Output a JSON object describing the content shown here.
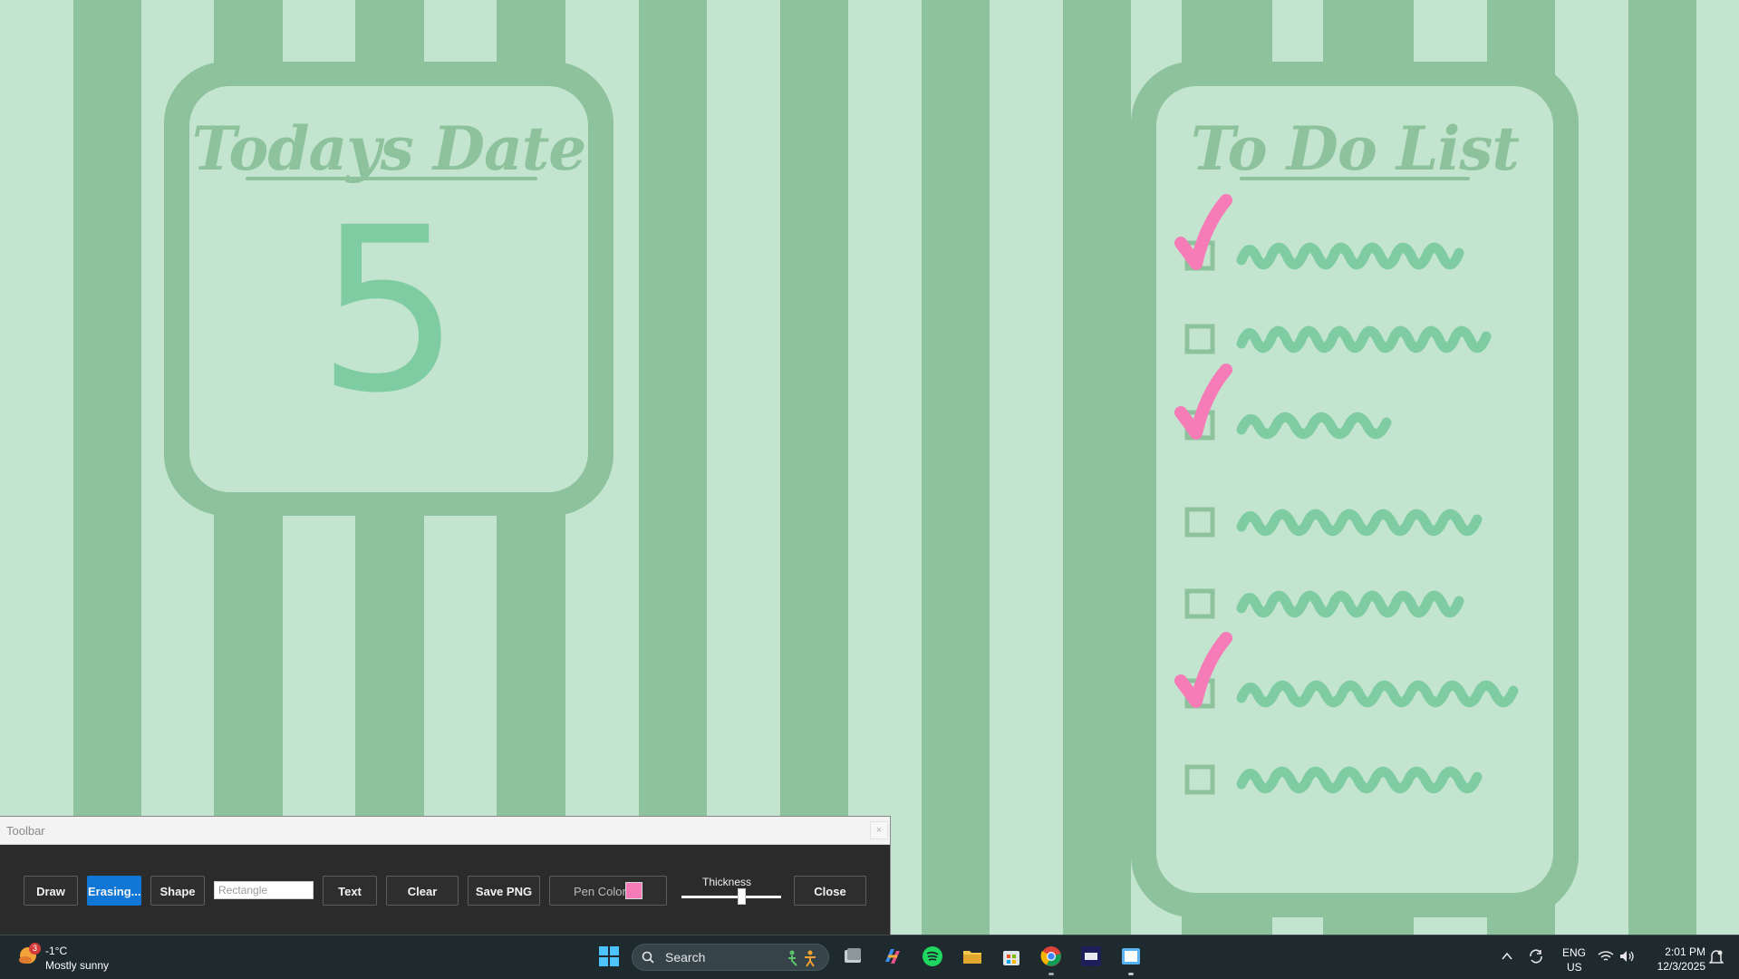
{
  "desktop": {
    "left_card": {
      "heading": "Todays Date",
      "value": "5"
    },
    "right_card": {
      "heading": "To Do List",
      "items": [
        {
          "checked": true
        },
        {
          "checked": false
        },
        {
          "checked": true
        },
        {
          "checked": false
        },
        {
          "checked": false
        },
        {
          "checked": true
        },
        {
          "checked": false
        }
      ]
    },
    "colors": {
      "light_stripe": "#c3e5cf",
      "dark_stripe": "#8dc29d",
      "check_mark": "#f67cb8",
      "ink": "#7fcca2"
    }
  },
  "toolbar": {
    "title": "Toolbar",
    "close_x": "×",
    "buttons": {
      "draw": "Draw",
      "erase": "Erasing...",
      "shape": "Shape",
      "text": "Text",
      "clear": "Clear",
      "save": "Save PNG",
      "pen_color": "Pen Color",
      "close": "Close"
    },
    "shape_value": "Rectangle",
    "thickness_label": "Thickness",
    "thickness_level": 0.6,
    "pen_color_value": "#f67cb8",
    "active_button": "erase"
  },
  "taskbar": {
    "weather": {
      "temp": "-1°C",
      "condition": "Mostly sunny",
      "badge": "3"
    },
    "search_placeholder": "Search",
    "apps": [
      "start-icon",
      "task-view-icon",
      "copilot-icon",
      "spotify-icon",
      "file-explorer-icon",
      "store-icon",
      "chrome-icon",
      "app-icon",
      "paint-app-icon"
    ],
    "tray": {
      "lang": "ENG",
      "region": "US",
      "time": "2:01 PM",
      "date": "12/3/2025"
    }
  }
}
